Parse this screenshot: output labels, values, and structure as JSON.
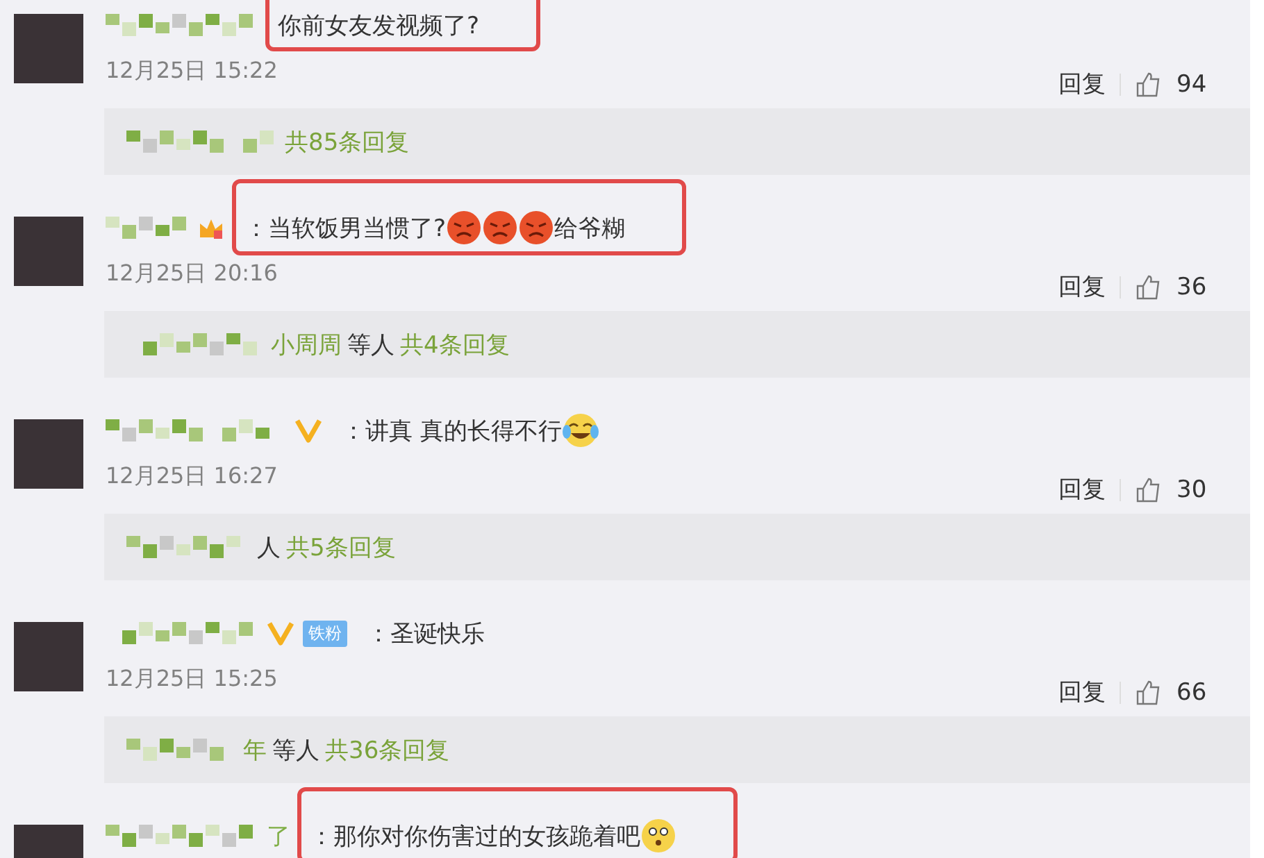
{
  "comments": [
    {
      "message": [
        {
          "kind": "text",
          "text": "你前女友发视频了?"
        }
      ],
      "highlighted": true,
      "date": "12月25日 15:22",
      "reply_label": "回复",
      "likes": "94",
      "replies": {
        "count": "共85条回复"
      }
    },
    {
      "badges": [
        {
          "kind": "vip"
        }
      ],
      "separator": "：",
      "message": [
        {
          "kind": "text",
          "text": "当软饭男当惯了?"
        },
        {
          "kind": "angry"
        },
        {
          "kind": "angry"
        },
        {
          "kind": "angry"
        },
        {
          "kind": "text",
          "text": "给爷糊"
        }
      ],
      "highlighted": true,
      "date": "12月25日 20:16",
      "reply_label": "回复",
      "likes": "36",
      "replies": {
        "names": "小周周",
        "others": "等人",
        "count": "共4条回复"
      }
    },
    {
      "badges": [
        {
          "kind": "verified"
        }
      ],
      "separator": "：",
      "message": [
        {
          "kind": "text",
          "text": "讲真 真的长得不行"
        },
        {
          "kind": "laugh-cry"
        }
      ],
      "highlighted": false,
      "date": "12月25日 16:27",
      "reply_label": "回复",
      "likes": "30",
      "replies": {
        "others": "人",
        "count": "共5条回复"
      }
    },
    {
      "badges": [
        {
          "kind": "verified"
        },
        {
          "kind": "fan",
          "text": "铁粉"
        }
      ],
      "separator": "：",
      "message": [
        {
          "kind": "text",
          "text": "圣诞快乐"
        }
      ],
      "highlighted": false,
      "date": "12月25日 15:25",
      "reply_label": "回复",
      "likes": "66",
      "replies": {
        "names": "年",
        "others": "等人",
        "count": "共36条回复"
      }
    },
    {
      "name_tail": "了",
      "separator": "：",
      "message": [
        {
          "kind": "text",
          "text": "那你对你伤害过的女孩跪着吧"
        },
        {
          "kind": "shocked"
        }
      ],
      "highlighted": true
    }
  ]
}
